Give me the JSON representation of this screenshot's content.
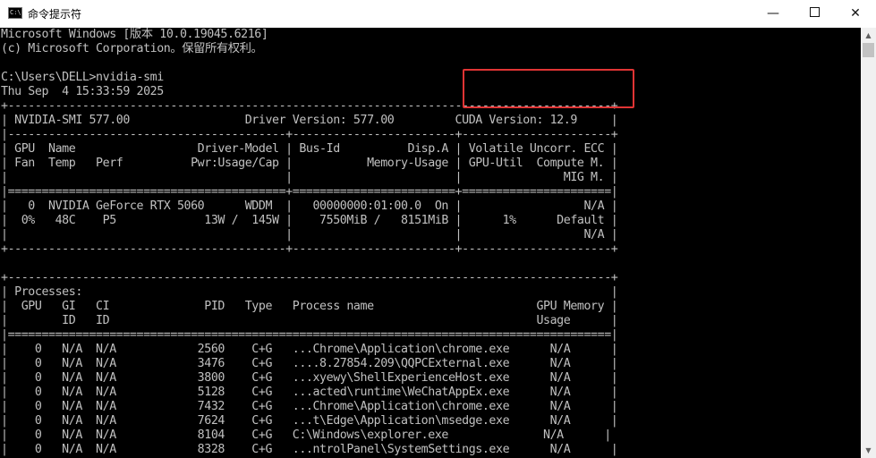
{
  "window": {
    "title": "命令提示符",
    "app_icon_text": "C:\\",
    "minimize_glyph": "—",
    "close_glyph": "✕"
  },
  "console": {
    "lines": [
      "Microsoft Windows [版本 10.0.19045.6216]",
      "(c) Microsoft Corporation。保留所有权利。",
      "",
      "C:\\Users\\DELL>nvidia-smi",
      "Thu Sep  4 15:33:59 2025",
      "+-----------------------------------------------------------------------------------------+",
      "| NVIDIA-SMI 577.00                 Driver Version: 577.00         CUDA Version: 12.9     |",
      "|-----------------------------------------+------------------------+----------------------+",
      "| GPU  Name                  Driver-Model | Bus-Id          Disp.A | Volatile Uncorr. ECC |",
      "| Fan  Temp   Perf          Pwr:Usage/Cap |           Memory-Usage | GPU-Util  Compute M. |",
      "|                                         |                        |               MIG M. |",
      "|=========================================+========================+======================|",
      "|   0  NVIDIA GeForce RTX 5060      WDDM  |   00000000:01:00.0  On |                  N/A |",
      "|  0%   48C    P5             13W /  145W |    7550MiB /   8151MiB |      1%      Default |",
      "|                                         |                        |                  N/A |",
      "+-----------------------------------------+------------------------+----------------------+",
      "",
      "+-----------------------------------------------------------------------------------------+",
      "| Processes:                                                                              |",
      "|  GPU   GI   CI              PID   Type   Process name                        GPU Memory |",
      "|        ID   ID                                                               Usage      |",
      "|=========================================================================================|",
      "|    0   N/A  N/A            2560    C+G   ...Chrome\\Application\\chrome.exe      N/A      |",
      "|    0   N/A  N/A            3476    C+G   ....8.27854.209\\QQPCExternal.exe      N/A      |",
      "|    0   N/A  N/A            3800    C+G   ...xyewy\\ShellExperienceHost.exe      N/A      |",
      "|    0   N/A  N/A            5128    C+G   ...acted\\runtime\\WeChatAppEx.exe      N/A      |",
      "|    0   N/A  N/A            7432    C+G   ...Chrome\\Application\\chrome.exe      N/A      |",
      "|    0   N/A  N/A            7624    C+G   ...t\\Edge\\Application\\msedge.exe      N/A      |",
      "|    0   N/A  N/A            8104    C+G   C:\\Windows\\explorer.exe              N/A      |",
      "|    0   N/A  N/A            8328    C+G   ...ntrolPanel\\SystemSettings.exe      N/A      |"
    ]
  },
  "annotation": {
    "color": "#e03434"
  }
}
